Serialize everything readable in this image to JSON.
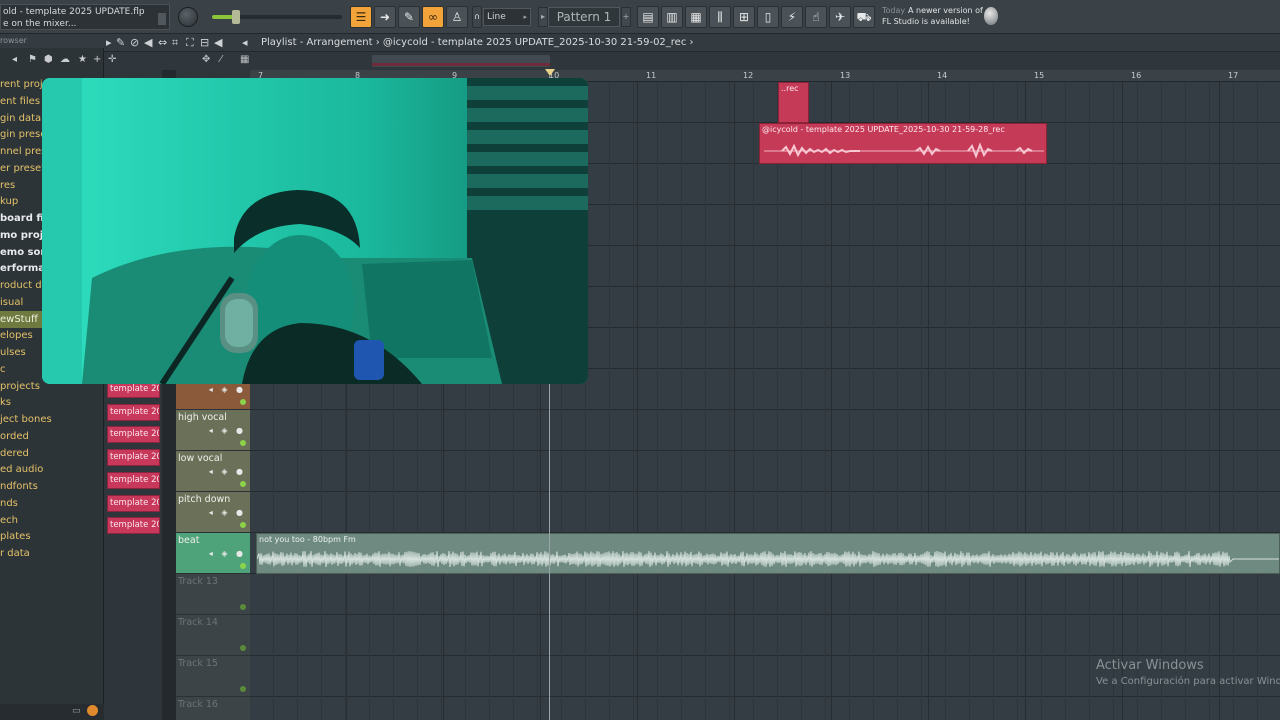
{
  "app": {
    "title_line1": "old - template 2025 UPDATE.flp",
    "title_line2": "e on the mixer..."
  },
  "toolbar": {
    "snap": "Line",
    "pattern": "Pattern 1",
    "news_today": "Today",
    "news_line1": "A newer version of",
    "news_line2": "FL Studio is available!"
  },
  "browser": {
    "header": "rowser",
    "items": [
      {
        "label": "rent proje",
        "style": "gold"
      },
      {
        "label": "ent files",
        "style": "gold"
      },
      {
        "label": "gin databa",
        "style": "gold"
      },
      {
        "label": "gin presets",
        "style": "gold"
      },
      {
        "label": "nnel prese",
        "style": "gold"
      },
      {
        "label": "er presets",
        "style": "gold"
      },
      {
        "label": "res",
        "style": "gold"
      },
      {
        "label": "kup",
        "style": "gold"
      },
      {
        "label": "board file",
        "style": "white"
      },
      {
        "label": "mo project",
        "style": "white"
      },
      {
        "label": "emo song",
        "style": "white"
      },
      {
        "label": "erforman",
        "style": "white"
      },
      {
        "label": "roduct de",
        "style": "gold"
      },
      {
        "label": "isual",
        "style": "gold"
      },
      {
        "label": "ewStuff",
        "style": "sel"
      },
      {
        "label": "elopes",
        "style": "gold"
      },
      {
        "label": "ulses",
        "style": "gold"
      },
      {
        "label": "c",
        "style": "gold"
      },
      {
        "label": "projects",
        "style": "gold"
      },
      {
        "label": "ks",
        "style": "gold"
      },
      {
        "label": "ject bones",
        "style": "gold"
      },
      {
        "label": "orded",
        "style": "gold"
      },
      {
        "label": "dered",
        "style": "gold"
      },
      {
        "label": "ed audio",
        "style": "gold"
      },
      {
        "label": "ndfonts",
        "style": "gold"
      },
      {
        "label": "nds",
        "style": "gold"
      },
      {
        "label": "ech",
        "style": "gold"
      },
      {
        "label": "plates",
        "style": "gold"
      },
      {
        "label": "r data",
        "style": "gold"
      }
    ]
  },
  "playlist": {
    "title": "Playlist - Arrangement",
    "separator": "›",
    "arrangement": "@icycold - template 2025 UPDATE_2025-10-30 21-59-02_rec",
    "ruler": [
      "7",
      "8",
      "9",
      "10",
      "11",
      "12",
      "13",
      "14",
      "15",
      "16",
      "17"
    ],
    "pattern_clips": [
      "template 202..",
      "template 202..",
      "template 202..",
      "template 202..",
      "template 202..",
      "template 202..",
      "template 202.."
    ],
    "tracks": [
      {
        "name": "",
        "style": "brown"
      },
      {
        "name": "high vocal",
        "style": "olive"
      },
      {
        "name": "low vocal",
        "style": "olive"
      },
      {
        "name": "pitch down",
        "style": "olive"
      },
      {
        "name": "beat",
        "style": "green"
      },
      {
        "name": "Track 13",
        "style": "empty"
      },
      {
        "name": "Track 14",
        "style": "empty"
      },
      {
        "name": "Track 15",
        "style": "empty"
      },
      {
        "name": "Track 16",
        "style": "empty"
      }
    ],
    "clips": {
      "small_rec": "..rec",
      "rec": "@icycold - template 2025 UPDATE_2025-10-30 21-59-28_rec",
      "beat": "not you too - 80bpm Fm"
    }
  },
  "watermark": {
    "line1": "Activar Windows",
    "line2": "Ve a Configuración para activar Windo"
  },
  "colors": {
    "accent": "#f2a43b",
    "audio_clip": "#c53a57",
    "beat_clip": "#6f8a81",
    "selected_folder": "#6e7a3f"
  }
}
